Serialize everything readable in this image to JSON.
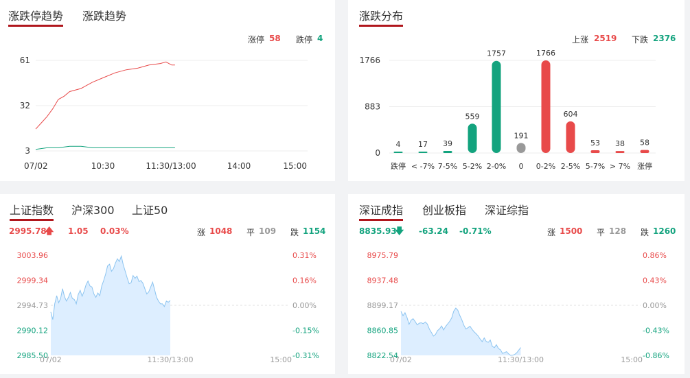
{
  "colors": {
    "red": "#e84a4a",
    "green": "#13a37e",
    "gray": "#999999",
    "tab_underline": "#b0161c",
    "area_fill": "#ddeeff",
    "area_line": "#8cc4f0"
  },
  "limit_trend": {
    "tabs": [
      "涨跌停趋势",
      "涨跌趋势"
    ],
    "limit_up_label": "涨停",
    "limit_up_value": "58",
    "limit_down_label": "跌停",
    "limit_down_value": "4",
    "y_ticks": [
      "61",
      "32",
      "3"
    ],
    "x_ticks": [
      "07/02",
      "10:30",
      "11:30/13:00",
      "14:00",
      "15:00"
    ]
  },
  "distribution": {
    "tabs": [
      "涨跌分布"
    ],
    "rise_label": "上涨",
    "rise_value": "2519",
    "fall_label": "下跌",
    "fall_value": "2376",
    "y_ticks": [
      "1766",
      "883",
      "0"
    ]
  },
  "sh_index": {
    "tabs": [
      "上证指数",
      "沪深300",
      "上证50"
    ],
    "price": "2995.78",
    "change": "1.05",
    "change_pct": "0.03%",
    "up_label": "涨",
    "up_value": "1048",
    "flat_label": "平",
    "flat_value": "109",
    "down_label": "跌",
    "down_value": "1154",
    "y_ticks": [
      "3003.96",
      "2999.34",
      "2994.73",
      "2990.12",
      "2985.50"
    ],
    "pct_ticks": [
      "0.31%",
      "0.16%",
      "0.00%",
      "-0.15%",
      "-0.31%"
    ],
    "x_ticks": [
      "07/02",
      "11:30/13:00",
      "15:00"
    ]
  },
  "sz_index": {
    "tabs": [
      "深证成指",
      "创业板指",
      "深证综指"
    ],
    "price": "8835.93",
    "change": "-63.24",
    "change_pct": "-0.71%",
    "up_label": "涨",
    "up_value": "1500",
    "flat_label": "平",
    "flat_value": "128",
    "down_label": "跌",
    "down_value": "1260",
    "y_ticks": [
      "8975.79",
      "8937.48",
      "8899.17",
      "8860.85",
      "8822.54"
    ],
    "pct_ticks": [
      "0.86%",
      "0.43%",
      "0.00%",
      "-0.43%",
      "-0.86%"
    ],
    "x_ticks": [
      "07/02",
      "11:30/13:00",
      "15:00"
    ]
  },
  "chart_data": [
    {
      "type": "line",
      "y_range": [
        3,
        61
      ],
      "x_range": [
        "09:30",
        "15:00"
      ],
      "series": [
        {
          "color": "#e84a4a",
          "points": [
            [
              0,
              17
            ],
            [
              5,
              21
            ],
            [
              10,
              25
            ],
            [
              15,
              30
            ],
            [
              20,
              36
            ],
            [
              25,
              38
            ],
            [
              30,
              41
            ],
            [
              40,
              43
            ],
            [
              50,
              47
            ],
            [
              60,
              50
            ],
            [
              70,
              53
            ],
            [
              80,
              55
            ],
            [
              90,
              56
            ],
            [
              100,
              58
            ],
            [
              110,
              59
            ],
            [
              115,
              60
            ],
            [
              120,
              58
            ],
            [
              123,
              58
            ]
          ]
        },
        {
          "color": "#13a37e",
          "points": [
            [
              0,
              4
            ],
            [
              10,
              5
            ],
            [
              20,
              5
            ],
            [
              30,
              6
            ],
            [
              40,
              6
            ],
            [
              50,
              5
            ],
            [
              70,
              5
            ],
            [
              90,
              5
            ],
            [
              110,
              5
            ],
            [
              123,
              5
            ]
          ]
        }
      ]
    },
    {
      "type": "bar",
      "categories": [
        "跌停",
        "< -7%",
        "7-5%",
        "5-2%",
        "2-0%",
        "0",
        "0-2%",
        "2-5%",
        "5-7%",
        "> 7%",
        "涨停"
      ],
      "values": [
        4,
        17,
        39,
        559,
        1757,
        191,
        1766,
        604,
        53,
        38,
        58
      ],
      "ylim": [
        0,
        1766
      ]
    },
    {
      "type": "area",
      "y_range": [
        2985.5,
        3003.96
      ],
      "x_range": [
        "09:30",
        "15:00"
      ],
      "values": [
        2993.5,
        2992.1,
        2995.0,
        2996.5,
        2995.2,
        2996.0,
        2997.8,
        2996.3,
        2995.5,
        2996.2,
        2997.1,
        2996.0,
        2995.8,
        2995.0,
        2996.7,
        2997.5,
        2996.4,
        2997.3,
        2998.5,
        2999.2,
        2998.3,
        2998.1,
        2996.8,
        2996.2,
        2997.0,
        2996.5,
        2998.3,
        2999.3,
        3000.5,
        3002.0,
        3002.3,
        3001.0,
        3001.5,
        3002.5,
        3003.3,
        3002.8,
        3003.8,
        3002.2,
        3001.0,
        2999.8,
        2998.7,
        2998.9,
        3000.2,
        2999.7,
        3000.1,
        2999.1,
        2999.3,
        2998.8,
        2997.8,
        2996.8,
        2997.2,
        2998.1,
        2999.0,
        2997.6,
        2996.2,
        2995.5,
        2995.0,
        2995.0,
        2994.5,
        2995.5,
        2995.3,
        2995.6
      ]
    },
    {
      "type": "area",
      "y_range": [
        8822.54,
        8975.79
      ],
      "x_range": [
        "09:30",
        "15:00"
      ],
      "values": [
        8890.0,
        8883.2,
        8887.8,
        8880.3,
        8870.1,
        8876.4,
        8878.6,
        8874.3,
        8869.1,
        8871.8,
        8872.4,
        8871.0,
        8873.7,
        8870.5,
        8862.7,
        8857.4,
        8852.0,
        8854.6,
        8860.3,
        8863.1,
        8867.6,
        8861.5,
        8866.8,
        8870.6,
        8874.6,
        8879.8,
        8890.2,
        8894.9,
        8891.6,
        8883.4,
        8876.8,
        8868.5,
        8863.0,
        8864.8,
        8867.1,
        8862.4,
        8858.7,
        8855.7,
        8852.2,
        8847.6,
        8843.5,
        8849.3,
        8843.8,
        8842.6,
        8846.0,
        8836.3,
        8834.4,
        8838.8,
        8833.0,
        8831.1,
        8825.6,
        8826.7,
        8828.2,
        8824.9,
        8822.5,
        8822.9,
        8823.9,
        8826.4,
        8830.5,
        8834.5
      ]
    }
  ]
}
